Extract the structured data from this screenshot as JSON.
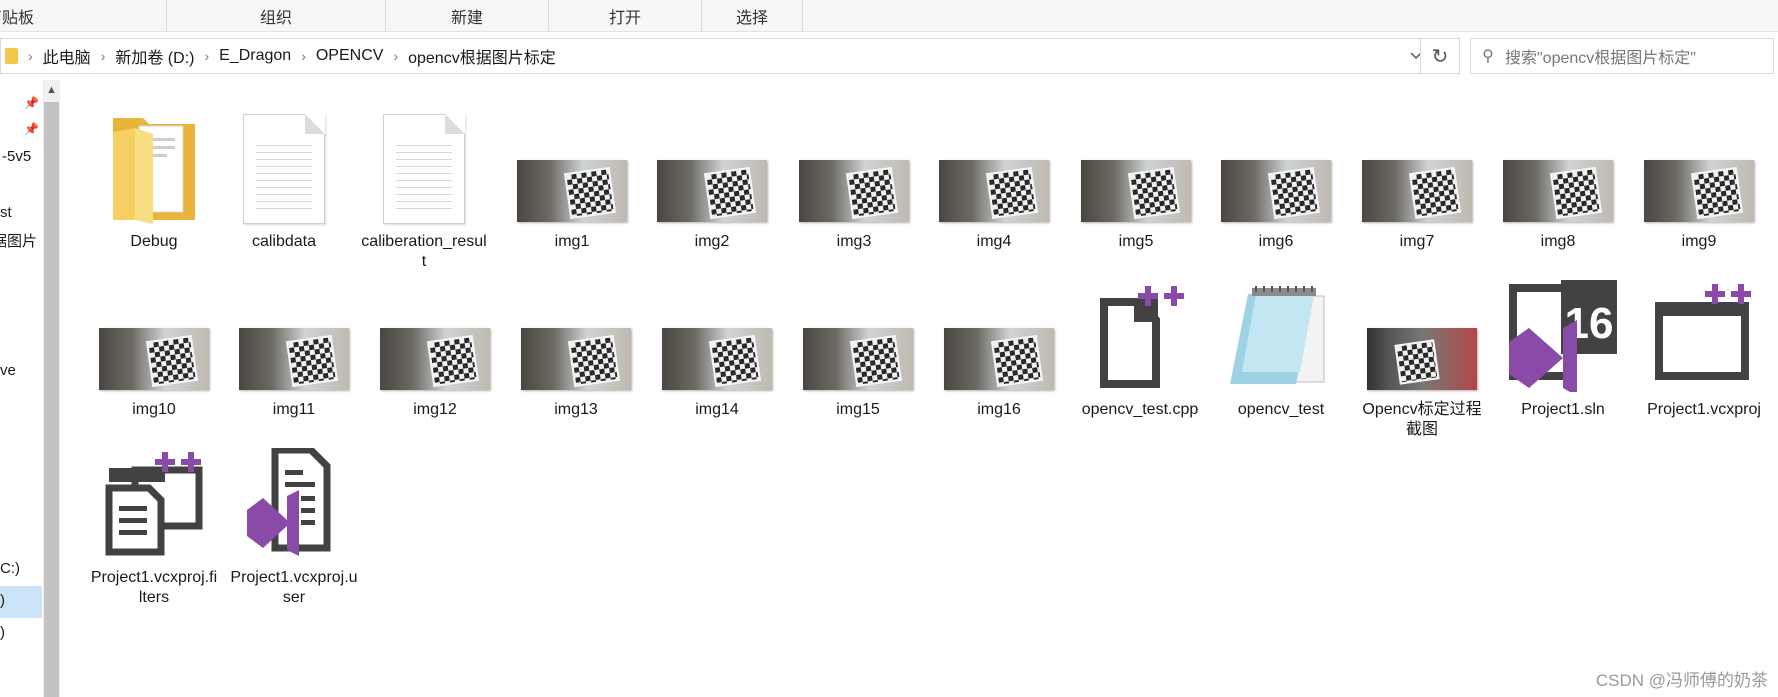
{
  "ribbon": {
    "groups": [
      "剪贴板",
      "组织",
      "新建",
      "打开",
      "选择"
    ]
  },
  "address": {
    "crumbs": [
      "此电脑",
      "新加卷 (D:)",
      "E_Dragon",
      "OPENCV",
      "opencv根据图片标定"
    ]
  },
  "search": {
    "placeholder": "搜索\"opencv根据图片标定\""
  },
  "nav": {
    "items": [
      "-5v5",
      "st",
      "据图片",
      "ve",
      "C:)",
      ")",
      ")"
    ]
  },
  "files": [
    {
      "name": "Debug",
      "type": "folder"
    },
    {
      "name": "calibdata",
      "type": "doc"
    },
    {
      "name": "caliberation_result",
      "type": "doc"
    },
    {
      "name": "img1",
      "type": "photo"
    },
    {
      "name": "img2",
      "type": "photo"
    },
    {
      "name": "img3",
      "type": "photo"
    },
    {
      "name": "img4",
      "type": "photo"
    },
    {
      "name": "img5",
      "type": "photo"
    },
    {
      "name": "img6",
      "type": "photo"
    },
    {
      "name": "img7",
      "type": "photo"
    },
    {
      "name": "img8",
      "type": "photo"
    },
    {
      "name": "img9",
      "type": "photo"
    },
    {
      "name": "img10",
      "type": "photo"
    },
    {
      "name": "img11",
      "type": "photo"
    },
    {
      "name": "img12",
      "type": "photo"
    },
    {
      "name": "img13",
      "type": "photo"
    },
    {
      "name": "img14",
      "type": "photo"
    },
    {
      "name": "img15",
      "type": "photo"
    },
    {
      "name": "img16",
      "type": "photo"
    },
    {
      "name": "opencv_test.cpp",
      "type": "cpp"
    },
    {
      "name": "opencv_test",
      "type": "exe"
    },
    {
      "name": "Opencv标定过程截图",
      "type": "screenshot"
    },
    {
      "name": "Project1.sln",
      "type": "sln"
    },
    {
      "name": "Project1.vcxproj",
      "type": "vcxproj"
    },
    {
      "name": "Project1.vcxproj.filters",
      "type": "filters"
    },
    {
      "name": "Project1.vcxproj.user",
      "type": "user"
    }
  ],
  "colors": {
    "vs_purple": "#8a4ba8",
    "folder_yellow": "#f4c64a",
    "selection": "#cce4f7"
  },
  "watermark": "CSDN @冯师傅的奶茶"
}
